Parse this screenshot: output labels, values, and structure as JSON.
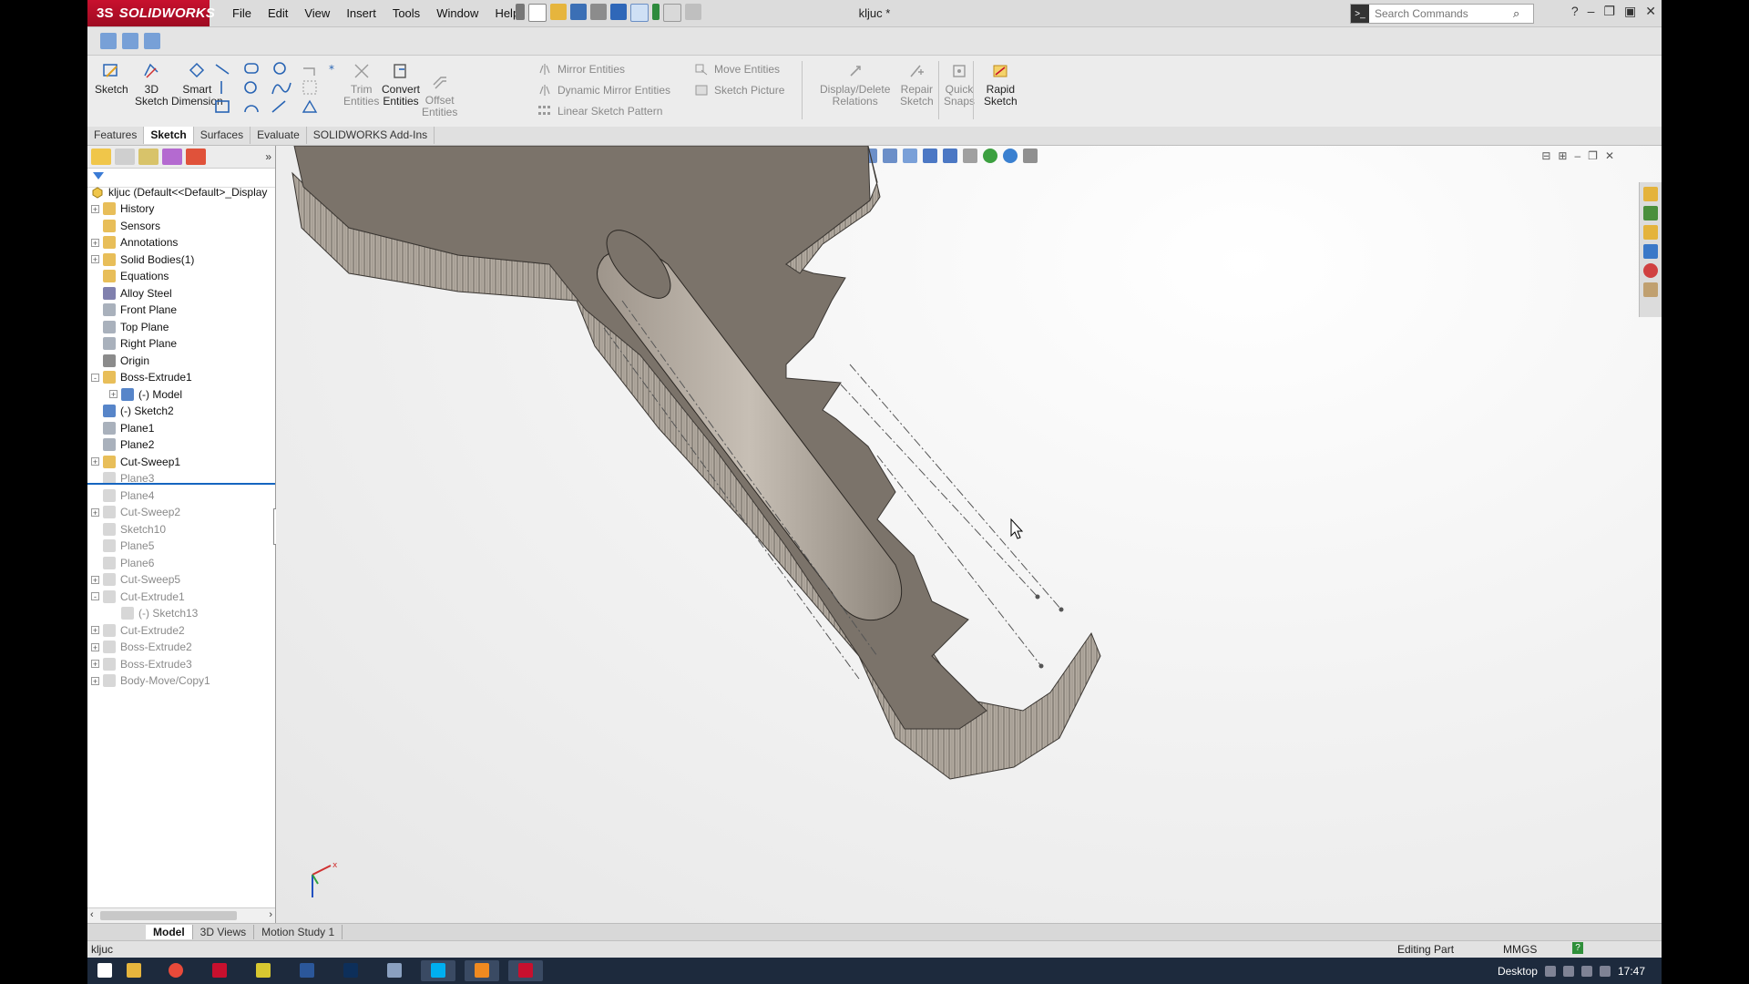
{
  "app": {
    "brand": "SOLIDWORKS",
    "brand_prefix": "3S",
    "document_title": "kljuc *",
    "menu": [
      "File",
      "Edit",
      "View",
      "Insert",
      "Tools",
      "Window",
      "Help"
    ],
    "search_placeholder": "Search Commands"
  },
  "commands": {
    "sketch": "Sketch",
    "sketch3d_a": "3D",
    "sketch3d_b": "Sketch",
    "smart_dim_a": "Smart",
    "smart_dim_b": "Dimension",
    "trim_a": "Trim",
    "trim_b": "Entities",
    "convert_a": "Convert",
    "convert_b": "Entities",
    "offset_a": "Offset",
    "offset_b": "Entities",
    "mirror": "Mirror Entities",
    "dyn_mirror": "Dynamic Mirror Entities",
    "linear_pattern": "Linear Sketch Pattern",
    "move": "Move Entities",
    "sketch_picture": "Sketch Picture",
    "display_delete_a": "Display/Delete",
    "display_delete_b": "Relations",
    "repair_a": "Repair",
    "repair_b": "Sketch",
    "quick_snaps_a": "Quick",
    "quick_snaps_b": "Snaps",
    "rapid_a": "Rapid",
    "rapid_b": "Sketch"
  },
  "tabs": [
    "Features",
    "Sketch",
    "Surfaces",
    "Evaluate",
    "SOLIDWORKS Add-Ins"
  ],
  "active_tab": "Sketch",
  "tree": {
    "root": "kljuc  (Default<<Default>_Display",
    "items": [
      {
        "label": "History",
        "icon": "history-folder-icon",
        "expand": "+",
        "state": "normal"
      },
      {
        "label": "Sensors",
        "icon": "sensors-folder-icon",
        "expand": "",
        "state": "normal"
      },
      {
        "label": "Annotations",
        "icon": "annotations-icon",
        "expand": "+",
        "state": "normal"
      },
      {
        "label": "Solid Bodies(1)",
        "icon": "solid-bodies-icon",
        "expand": "+",
        "state": "normal"
      },
      {
        "label": "Equations",
        "icon": "equations-icon",
        "expand": "",
        "state": "normal"
      },
      {
        "label": "Alloy Steel",
        "icon": "material-icon",
        "expand": "",
        "state": "normal"
      },
      {
        "label": "Front Plane",
        "icon": "plane-icon",
        "expand": "",
        "state": "normal"
      },
      {
        "label": "Top Plane",
        "icon": "plane-icon",
        "expand": "",
        "state": "normal"
      },
      {
        "label": "Right Plane",
        "icon": "plane-icon",
        "expand": "",
        "state": "normal"
      },
      {
        "label": "Origin",
        "icon": "origin-icon",
        "expand": "",
        "state": "normal"
      },
      {
        "label": "Boss-Extrude1",
        "icon": "boss-extrude-icon",
        "expand": "-",
        "state": "normal"
      },
      {
        "label": "(-) Model",
        "icon": "sketch-icon",
        "expand": "+",
        "state": "child"
      },
      {
        "label": "(-) Sketch2",
        "icon": "sketch-icon",
        "expand": "",
        "state": "normal"
      },
      {
        "label": "Plane1",
        "icon": "plane-icon",
        "expand": "",
        "state": "normal"
      },
      {
        "label": "Plane2",
        "icon": "plane-icon",
        "expand": "",
        "state": "normal"
      },
      {
        "label": "Cut-Sweep1",
        "icon": "cut-sweep-icon",
        "expand": "+",
        "state": "normal"
      },
      {
        "label": "Plane3",
        "icon": "plane-icon",
        "expand": "",
        "state": "suppressed"
      },
      {
        "label": "Plane4",
        "icon": "plane-icon",
        "expand": "",
        "state": "suppressed"
      },
      {
        "label": "Cut-Sweep2",
        "icon": "cut-sweep-icon",
        "expand": "+",
        "state": "suppressed"
      },
      {
        "label": "Sketch10",
        "icon": "sketch-icon",
        "expand": "",
        "state": "suppressed"
      },
      {
        "label": "Plane5",
        "icon": "plane-icon",
        "expand": "",
        "state": "suppressed"
      },
      {
        "label": "Plane6",
        "icon": "plane-icon",
        "expand": "",
        "state": "suppressed"
      },
      {
        "label": "Cut-Sweep5",
        "icon": "cut-sweep-icon",
        "expand": "+",
        "state": "suppressed"
      },
      {
        "label": "Cut-Extrude1",
        "icon": "cut-extrude-icon",
        "expand": "-",
        "state": "suppressed"
      },
      {
        "label": "(-) Sketch13",
        "icon": "sketch-icon",
        "expand": "",
        "state": "suppressed-child"
      },
      {
        "label": "Cut-Extrude2",
        "icon": "cut-extrude-icon",
        "expand": "+",
        "state": "suppressed"
      },
      {
        "label": "Boss-Extrude2",
        "icon": "boss-extrude-icon",
        "expand": "+",
        "state": "suppressed"
      },
      {
        "label": "Boss-Extrude3",
        "icon": "boss-extrude-icon",
        "expand": "+",
        "state": "suppressed"
      },
      {
        "label": "Body-Move/Copy1",
        "icon": "move-copy-icon",
        "expand": "+",
        "state": "suppressed"
      }
    ]
  },
  "bottom_tabs": [
    "Model",
    "3D Views",
    "Motion Study 1"
  ],
  "active_bottom_tab": "Model",
  "status": {
    "left": "kljuc",
    "mode": "Editing Part",
    "units": "MMGS"
  },
  "taskbar": {
    "desktop": "Desktop",
    "time": "17:47"
  },
  "colors": {
    "brand_red": "#c8102e",
    "key_body": "#7b736a",
    "key_edge": "#9b9288",
    "taskbar": "#1d2a3d"
  }
}
